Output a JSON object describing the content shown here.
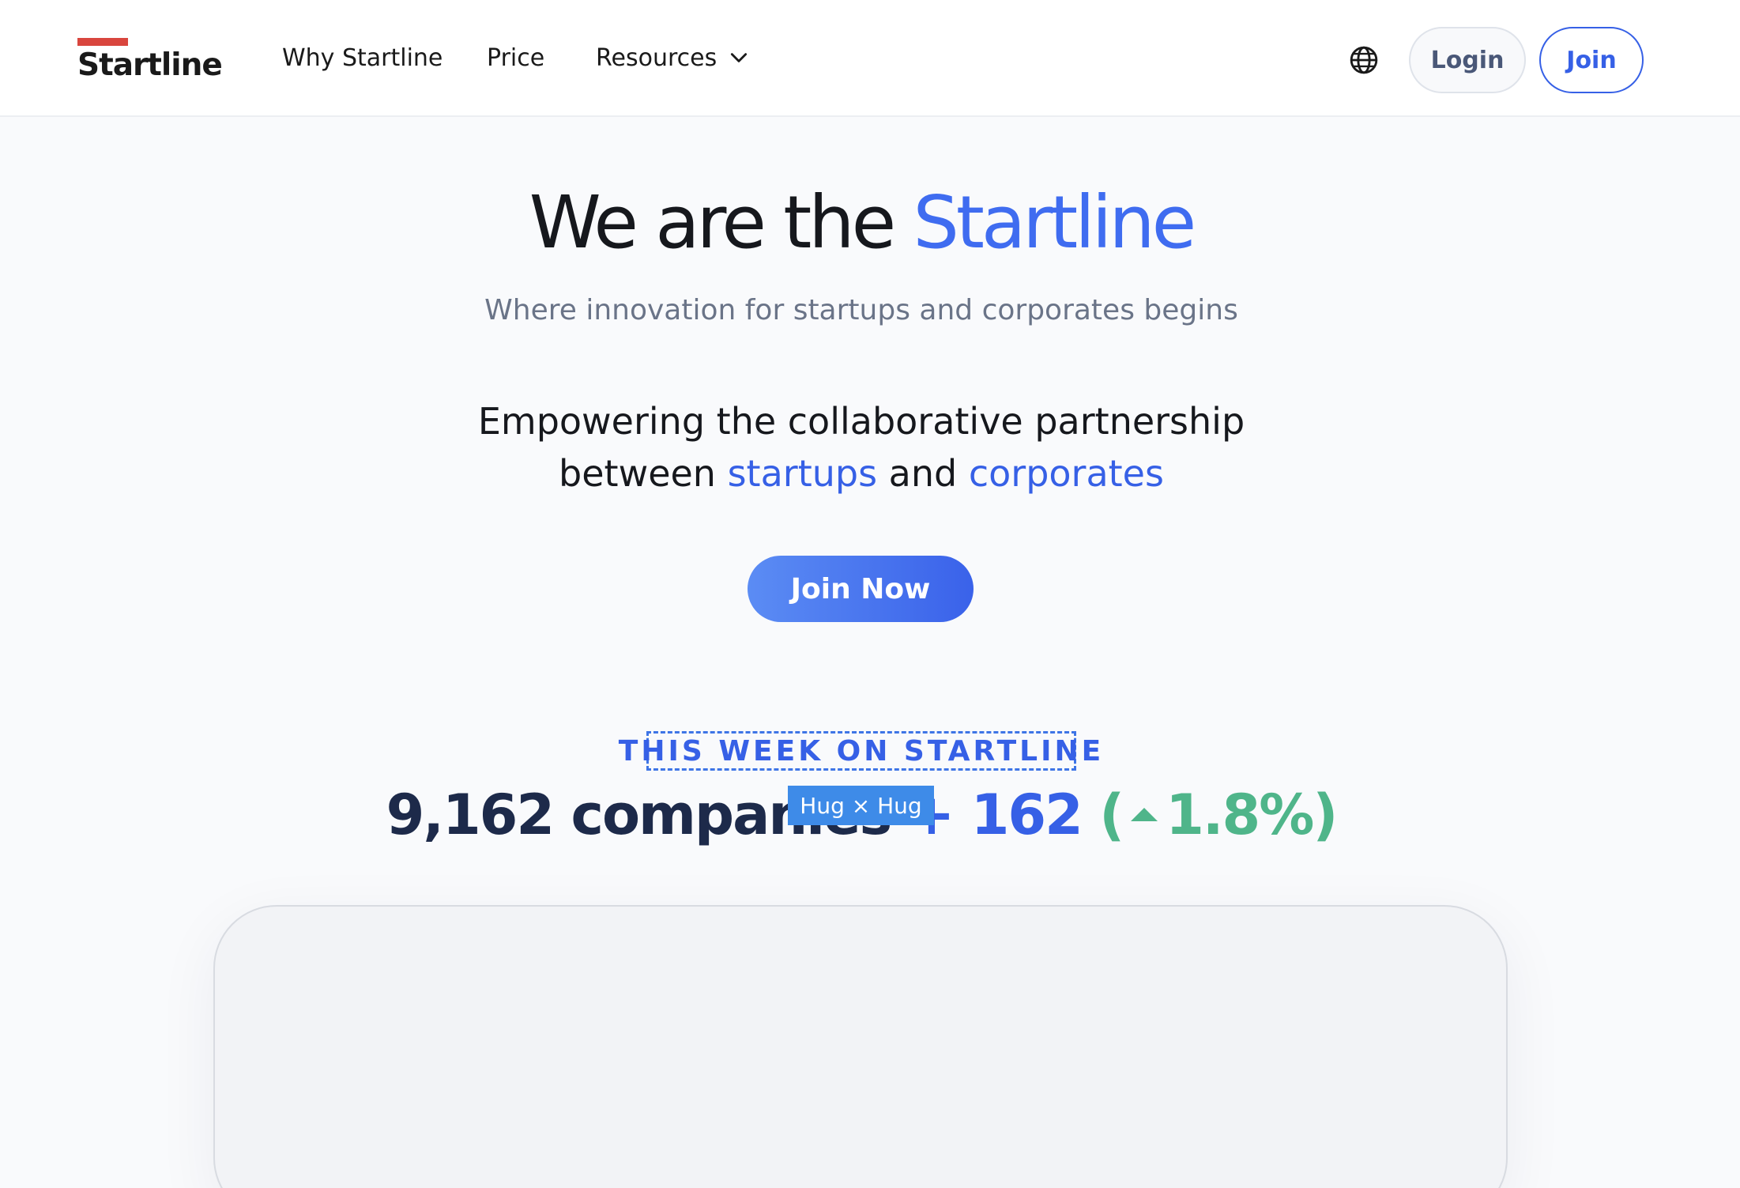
{
  "header": {
    "logo_text": "Startline",
    "nav": {
      "why": "Why Startline",
      "price": "Price",
      "resources": "Resources"
    },
    "login_label": "Login",
    "join_label": "Join"
  },
  "hero": {
    "title_prefix": "We are the ",
    "title_accent": "Startline",
    "subtitle": "Where innovation for startups and corporates begins",
    "body_line1": "Empowering the collaborative partnership",
    "body_line2_pre": "between ",
    "body_startups": "startups",
    "body_and": " and ",
    "body_corporates": "corporates",
    "cta_label": "Join Now"
  },
  "stats": {
    "section_label": "THIS WEEK ON STARTLINE",
    "companies": "9,162 companies",
    "plus": " + 162 ",
    "paren_open": "(",
    "percent": "1.8%)",
    "selection_tag": "Hug × Hug"
  },
  "colors": {
    "accent": "#3660e6",
    "positive": "#4fb58a",
    "logo_bar": "#d9463e"
  }
}
